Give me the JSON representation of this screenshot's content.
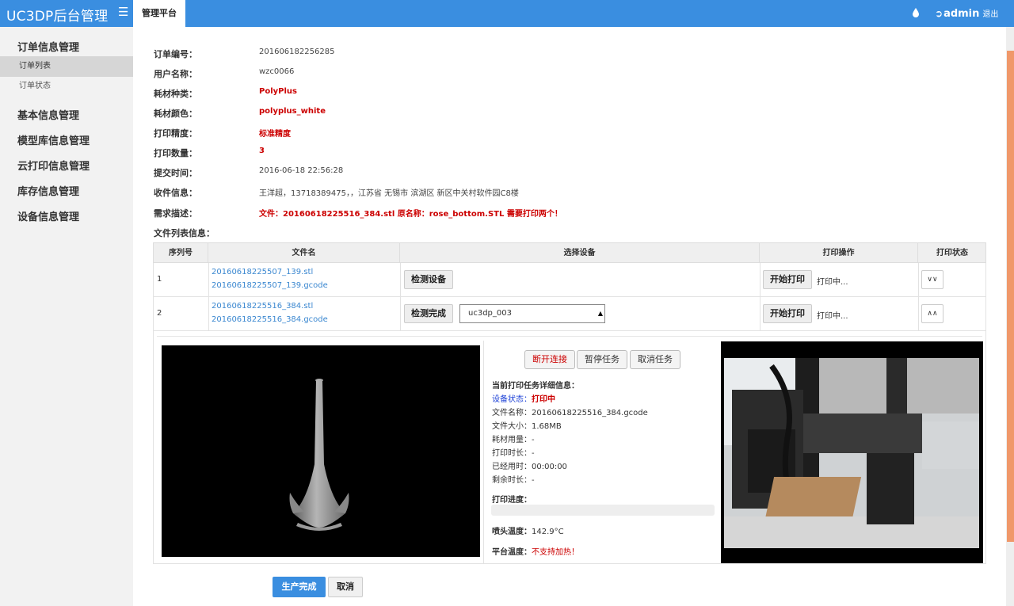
{
  "header": {
    "brand": "UC3DP后台管理",
    "menu_icon": "hamburger-icon",
    "active_tab": "管理平台",
    "user": "admin",
    "logout": "退出",
    "accent": "#3a8ee0"
  },
  "sidebar": {
    "groups": [
      {
        "label": "订单信息管理",
        "items": [
          "订单列表",
          "订单状态"
        ]
      },
      {
        "label": "基本信息管理"
      },
      {
        "label": "模型库信息管理"
      },
      {
        "label": "云打印信息管理"
      },
      {
        "label": "库存信息管理"
      },
      {
        "label": "设备信息管理"
      }
    ],
    "active_item": "订单列表"
  },
  "order": {
    "fields": [
      {
        "label": "订单编号：",
        "value": "201606182256285"
      },
      {
        "label": "用户名称：",
        "value": "wzc0066"
      },
      {
        "label": "耗材种类：",
        "value": "PolyPlus"
      },
      {
        "label": "耗材颜色：",
        "value": "polyplus_white"
      },
      {
        "label": "打印精度：",
        "value": "标准精度"
      },
      {
        "label": "打印数量：",
        "value": "3"
      },
      {
        "label": "提交时间：",
        "value": "2016-06-18 22:56:28"
      },
      {
        "label": "收件信息：",
        "value": "王洋超，13718389475，，江苏省 无锡市 滨湖区 新区中关村软件园C8楼"
      },
      {
        "label": "需求描述：",
        "value": "文件：20160618225516_384.stl 原名称：rose_bottom.STL 需要打印两个！"
      }
    ],
    "file_list_title": "文件列表信息："
  },
  "file_table": {
    "headers": [
      "序列号",
      "文件名",
      "选择设备",
      "打印操作",
      "打印状态"
    ],
    "rows": [
      {
        "index": "1",
        "files": [
          "20160618225507_139.stl",
          "20160618225507_139.gcode"
        ],
        "device_button": "检测设备",
        "print_button": "开始打印",
        "status": "打印中...",
        "toggle_icon": "chevron-double-down-icon"
      },
      {
        "index": "2",
        "files": [
          "20160618225516_384.stl",
          "20160618225516_384.gcode"
        ],
        "device_button": "检测完成",
        "device_select": "uc3dp_003",
        "print_button": "开始打印",
        "status": "打印中...",
        "toggle_icon": "chevron-double-up-icon"
      }
    ]
  },
  "task_panel": {
    "buttons": [
      "断开连接",
      "暂停任务",
      "取消任务"
    ],
    "title": "当前打印任务详细信息：",
    "device_status_label": "设备状态：",
    "device_status": "打印中",
    "file_name_label": "文件名称：",
    "file_name": "20160618225516_384.gcode",
    "file_size_label": "文件大小：",
    "file_size": "1.68MB",
    "material_label": "耗材用量：",
    "material": "-",
    "print_time_label": "打印时长：",
    "print_time": "-",
    "elapsed_label": "已经用时：",
    "elapsed": "00:00:00",
    "remaining_label": "剩余时长：",
    "remaining": "-",
    "progress_label": "打印进度：",
    "progress": 0,
    "nozzle_label": "喷头温度：",
    "nozzle": "142.9°C",
    "bed_label": "平台温度：",
    "bed": "不支持加热！"
  },
  "actions": {
    "confirm": "生产完成",
    "cancel": "取消"
  }
}
